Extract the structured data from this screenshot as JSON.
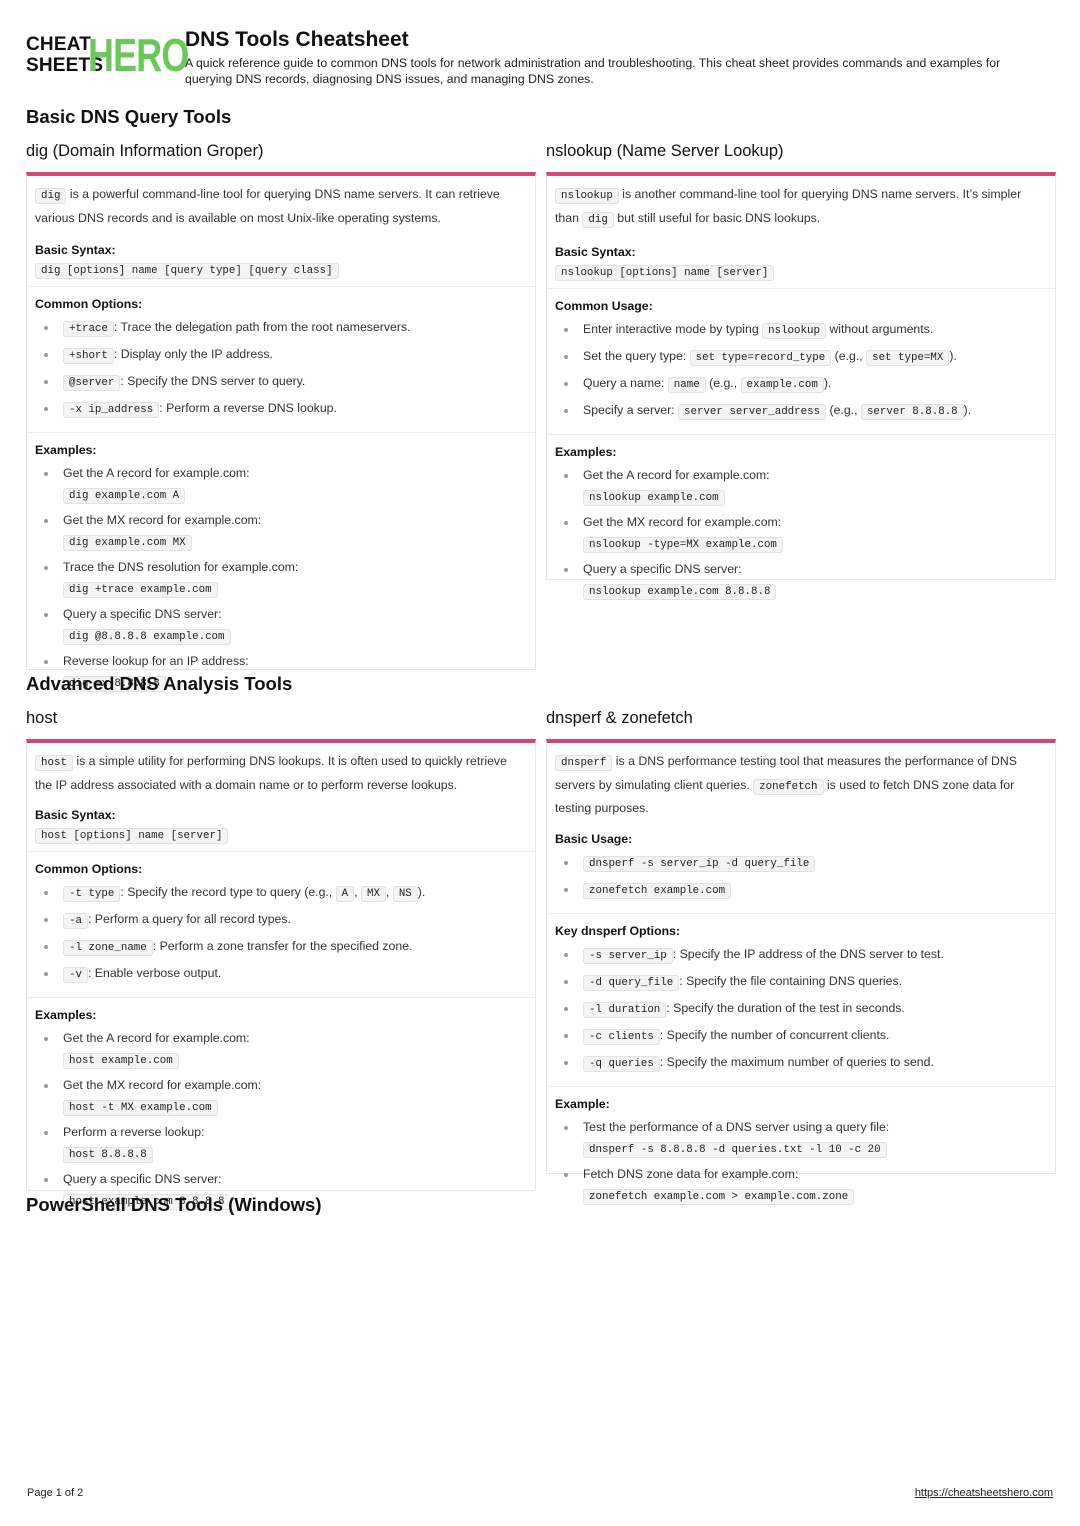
{
  "header": {
    "logo_line1": "CHEAT",
    "logo_line2": "SHEETS",
    "logo_hero": "HERO",
    "title": "DNS Tools Cheatsheet",
    "subtitle": "A quick reference guide to common DNS tools for network administration and troubleshooting. This cheat sheet provides commands and examples for querying DNS records, diagnosing DNS issues, and managing DNS zones."
  },
  "sections": {
    "basic": "Basic DNS Query Tools",
    "advanced": "Advanced DNS Analysis Tools",
    "powershell": "PowerShell DNS Tools (Windows)"
  },
  "dig": {
    "title": "dig (Domain Information Groper)",
    "intro_code": "dig",
    "intro": " is a powerful command-line tool for querying DNS name servers. It can retrieve various DNS records and is available on most Unix-like operating systems.",
    "syntax_label": "Basic Syntax:",
    "syntax": "dig [options] name [query type] [query class]",
    "options_label": "Common Options:",
    "options": [
      {
        "code": "+trace",
        "text": ": Trace the delegation path from the root nameservers."
      },
      {
        "code": "+short",
        "text": ": Display only the IP address."
      },
      {
        "code": "@server",
        "text": ": Specify the DNS server to query."
      },
      {
        "code": "-x ip_address",
        "text": ": Perform a reverse DNS lookup."
      }
    ],
    "examples_label": "Examples:",
    "examples": [
      {
        "text": "Get the A record for example.com:",
        "code": "dig example.com A"
      },
      {
        "text": "Get the MX record for example.com:",
        "code": "dig example.com MX"
      },
      {
        "text": "Trace the DNS resolution for example.com:",
        "code": "dig +trace example.com"
      },
      {
        "text": "Query a specific DNS server:",
        "code": "dig @8.8.8.8 example.com"
      },
      {
        "text": "Reverse lookup for an IP address:",
        "code": "dig -x 8.8.8.8"
      }
    ]
  },
  "nslookup": {
    "title": "nslookup (Name Server Lookup)",
    "intro_code": "nslookup",
    "intro_a": " is another command-line tool for querying DNS name servers. It’s simpler than ",
    "intro_code2": "dig",
    "intro_b": " but still useful for basic DNS lookups.",
    "syntax_label": "Basic Syntax:",
    "syntax": "nslookup [options] name [server]",
    "usage_label": "Common Usage:",
    "usage": [
      {
        "t1": "Enter interactive mode by typing ",
        "c1": "nslookup",
        "t2": " without arguments.",
        "c2": "",
        "t3": ""
      },
      {
        "t1": "Set the query type: ",
        "c1": "set type=record_type",
        "t2": " (e.g., ",
        "c2": "set type=MX",
        "t3": ")."
      },
      {
        "t1": "Query a name: ",
        "c1": "name",
        "t2": " (e.g., ",
        "c2": "example.com",
        "t3": ")."
      },
      {
        "t1": "Specify a server: ",
        "c1": "server server_address",
        "t2": " (e.g., ",
        "c2": "server 8.8.8.8",
        "t3": ")."
      }
    ],
    "examples_label": "Examples:",
    "examples": [
      {
        "text": "Get the A record for example.com:",
        "code": "nslookup example.com"
      },
      {
        "text": "Get the MX record for example.com:",
        "code": "nslookup -type=MX example.com"
      },
      {
        "text": "Query a specific DNS server:",
        "code": "nslookup example.com 8.8.8.8"
      }
    ]
  },
  "host": {
    "title": "host",
    "intro_code": "host",
    "intro": " is a simple utility for performing DNS lookups. It is often used to quickly retrieve the IP address associated with a domain name or to perform reverse lookups.",
    "syntax_label": "Basic Syntax:",
    "syntax": "host [options] name [server]",
    "options_label": "Common Options:",
    "opt_t_code": "-t type",
    "opt_t_text": ": Specify the record type to query (e.g., ",
    "opt_t_a": "A",
    "opt_t_mx": "MX",
    "opt_t_ns": "NS",
    "options": [
      {
        "code": "-a",
        "text": ": Perform a query for all record types."
      },
      {
        "code": "-l zone_name",
        "text": ": Perform a zone transfer for the specified zone."
      },
      {
        "code": "-v",
        "text": ": Enable verbose output."
      }
    ],
    "examples_label": "Examples:",
    "examples": [
      {
        "text": "Get the A record for example.com:",
        "code": "host example.com"
      },
      {
        "text": "Get the MX record for example.com:",
        "code": "host -t MX example.com"
      },
      {
        "text": "Perform a reverse lookup:",
        "code": "host 8.8.8.8"
      },
      {
        "text": "Query a specific DNS server:",
        "code": "host example.com 8.8.8.8"
      }
    ]
  },
  "dnsperf": {
    "title": "dnsperf & zonefetch",
    "intro_code": "dnsperf",
    "intro_a": " is a DNS performance testing tool that measures the performance of DNS servers by simulating client queries. ",
    "intro_code2": "zonefetch",
    "intro_b": " is used to fetch DNS zone data for testing purposes.",
    "usage_label": "Basic Usage:",
    "usage": [
      "dnsperf -s server_ip -d query_file",
      "zonefetch example.com"
    ],
    "options_label": "Key dnsperf Options:",
    "options": [
      {
        "code": "-s server_ip",
        "text": ": Specify the IP address of the DNS server to test."
      },
      {
        "code": "-d query_file",
        "text": ": Specify the file containing DNS queries."
      },
      {
        "code": "-l duration",
        "text": ": Specify the duration of the test in seconds."
      },
      {
        "code": "-c clients",
        "text": ": Specify the number of concurrent clients."
      },
      {
        "code": "-q queries",
        "text": ": Specify the maximum number of queries to send."
      }
    ],
    "example_label": "Example:",
    "examples": [
      {
        "text": "Test the performance of a DNS server using a query file:",
        "code": "dnsperf -s 8.8.8.8 -d queries.txt -l 10 -c 20"
      },
      {
        "text": "Fetch DNS zone data for example.com:",
        "code": "zonefetch example.com > example.com.zone"
      }
    ]
  },
  "footer": {
    "page": "Page 1 of 2",
    "link": "https://cheatsheetshero.com"
  },
  "colors": {
    "accent": "#d6457a",
    "logo_green": "#6ac858"
  }
}
